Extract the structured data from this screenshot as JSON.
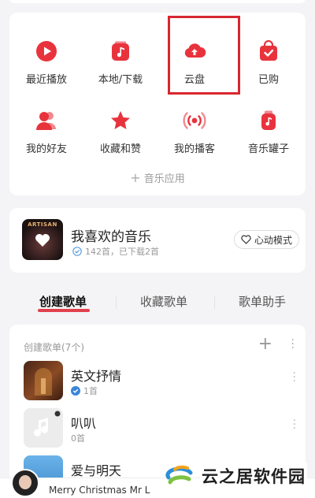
{
  "apps": {
    "items": [
      {
        "label": "最近播放",
        "icon": "play-icon"
      },
      {
        "label": "本地/下载",
        "icon": "music-note-icon"
      },
      {
        "label": "云盘",
        "icon": "cloud-upload-icon"
      },
      {
        "label": "已购",
        "icon": "shopping-bag-icon"
      },
      {
        "label": "我的好友",
        "icon": "friends-icon"
      },
      {
        "label": "收藏和赞",
        "icon": "star-icon"
      },
      {
        "label": "我的播客",
        "icon": "broadcast-icon"
      },
      {
        "label": "音乐罐子",
        "icon": "music-jar-icon"
      }
    ],
    "more_label": "音乐应用"
  },
  "favorites": {
    "title": "我喜欢的音乐",
    "subtitle": "142首，已下载2首",
    "cover_text": "ARTISAN",
    "mode_button": "心动模式"
  },
  "tabs": [
    {
      "label": "创建歌单",
      "active": true
    },
    {
      "label": "收藏歌单",
      "active": false
    },
    {
      "label": "歌单助手",
      "active": false
    }
  ],
  "playlists": {
    "header": "创建歌单(7个)",
    "items": [
      {
        "name": "英文抒情",
        "count": "1首"
      },
      {
        "name": "叭叭",
        "count": "0首"
      },
      {
        "name": "爱与明天",
        "count": ""
      }
    ]
  },
  "player": {
    "title": "Merry Christmas Mr L"
  },
  "watermark": {
    "text": "云之居软件园"
  },
  "colors": {
    "accent": "#e8333d",
    "highlight_box": "#d9262f",
    "background": "#f4f4f6"
  }
}
